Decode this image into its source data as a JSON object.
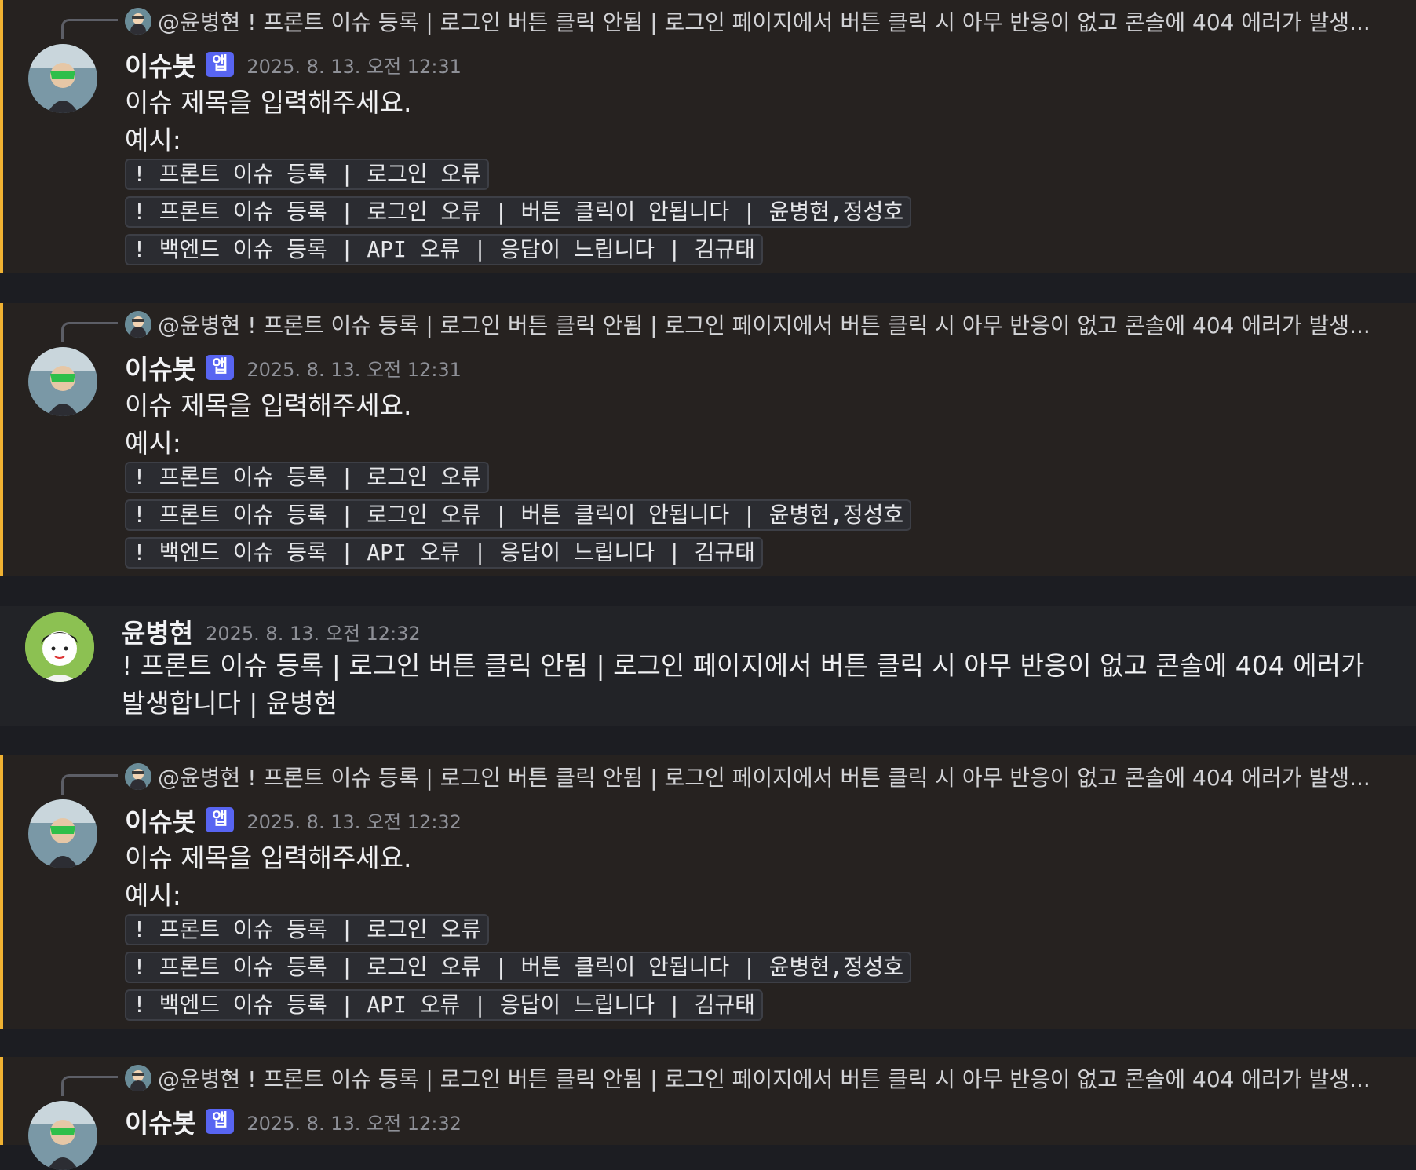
{
  "reply": {
    "mention": "@윤병현",
    "preview": "! 프론트 이슈 등록 | 로그인 버튼 클릭 안됨 | 로그인 페이지에서 버튼 클릭 시 아무 반응이 없고 콘솔에 404 에러가 발생..."
  },
  "bot": {
    "name": "이슈봇",
    "badge": "앱",
    "prompt": "이슈 제목을 입력해주세요.",
    "example_label": "예시:",
    "examples": [
      "! 프론트 이슈 등록 | 로그인 오류",
      "! 프론트 이슈 등록 | 로그인 오류 | 버튼 클릭이 안됩니다 | 윤병현,정성호",
      "! 백엔드 이슈 등록 | API 오류 | 응답이 느립니다 | 김규태"
    ]
  },
  "messages": [
    {
      "timestamp": "2025. 8. 13. 오전 12:31"
    },
    {
      "timestamp": "2025. 8. 13. 오전 12:31"
    },
    {
      "user": "윤병현",
      "timestamp": "2025. 8. 13. 오전 12:32",
      "text": "! 프론트 이슈 등록 | 로그인 버튼 클릭 안됨 | 로그인 페이지에서 버튼 클릭 시 아무 반응이 없고 콘솔에 404 에러가 발생합니다 | 윤병현"
    },
    {
      "timestamp": "2025. 8. 13. 오전 12:32"
    },
    {
      "timestamp": "2025. 8. 13. 오전 12:32"
    }
  ],
  "colors": {
    "background": "#1c1d22",
    "mention_highlight": "#f0b232",
    "app_badge": "#5865f2",
    "code_background": "#2b2c31"
  },
  "icons": [
    "bot-avatar",
    "user-avatar",
    "mini-avatar"
  ]
}
